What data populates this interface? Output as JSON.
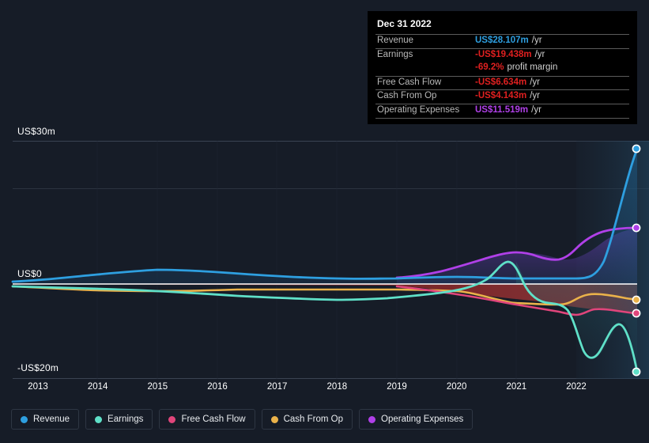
{
  "background_color": "#161c27",
  "axis": {
    "y_top_label": "US$30m",
    "y_zero_label": "US$0",
    "y_bottom_label": "-US$20m",
    "x_ticks": [
      "2013",
      "2014",
      "2015",
      "2016",
      "2017",
      "2018",
      "2019",
      "2020",
      "2021",
      "2022"
    ]
  },
  "tooltip": {
    "date": "Dec 31 2022",
    "rows": [
      {
        "label": "Revenue",
        "value": "US$28.107m",
        "suffix": "/yr",
        "color": "#2e9fe0"
      },
      {
        "label": "Earnings",
        "value": "-US$19.438m",
        "suffix": "/yr",
        "color": "#e02020"
      },
      {
        "label": "",
        "value": "-69.2%",
        "suffix": "profit margin",
        "color": "#e02020"
      },
      {
        "label": "Free Cash Flow",
        "value": "-US$6.634m",
        "suffix": "/yr",
        "color": "#e02020"
      },
      {
        "label": "Cash From Op",
        "value": "-US$4.143m",
        "suffix": "/yr",
        "color": "#e02020"
      },
      {
        "label": "Operating Expenses",
        "value": "US$11.519m",
        "suffix": "/yr",
        "color": "#b040e8"
      }
    ]
  },
  "legend": {
    "items": [
      {
        "label": "Revenue",
        "color": "#2e9fe0"
      },
      {
        "label": "Earnings",
        "color": "#5fe0c8"
      },
      {
        "label": "Free Cash Flow",
        "color": "#e0457b"
      },
      {
        "label": "Cash From Op",
        "color": "#eab24a"
      },
      {
        "label": "Operating Expenses",
        "color": "#b040e8"
      }
    ]
  },
  "chart_data": {
    "type": "line",
    "title": "",
    "xlabel": "",
    "ylabel": "US$",
    "ylim": [
      -20,
      30
    ],
    "xlim": [
      2012.7,
      2022.95
    ],
    "grid": true,
    "legend_position": "bottom",
    "y_ticks": [
      30,
      20,
      0,
      -20
    ],
    "y_tick_labels": [
      "US$30m",
      "",
      "US$0",
      "-US$20m"
    ],
    "x": [
      2013,
      2014,
      2015,
      2016,
      2017,
      2018,
      2019,
      2019.5,
      2020,
      2020.5,
      2021,
      2021.2,
      2021.5,
      2022,
      2022.3,
      2022.6,
      2022.9
    ],
    "series": [
      {
        "name": "Revenue",
        "color": "#2e9fe0",
        "values": [
          0.6,
          1.1,
          1.5,
          1.6,
          1.5,
          1.3,
          1.2,
          1.2,
          1.4,
          1.3,
          1.2,
          1.2,
          1.0,
          1.0,
          1.0,
          14.0,
          28.107
        ]
      },
      {
        "name": "Earnings",
        "color": "#5fe0c8",
        "values": [
          -0.6,
          -0.7,
          -0.8,
          -1.0,
          -1.3,
          -1.8,
          -2.2,
          -2.3,
          -2.3,
          -2.0,
          3.2,
          -1.2,
          -2.0,
          -12.5,
          -15.0,
          -9.5,
          -19.438
        ]
      },
      {
        "name": "Free Cash Flow",
        "color": "#e0457b",
        "values": [
          null,
          null,
          null,
          null,
          null,
          null,
          -0.9,
          -1.2,
          -1.9,
          -2.6,
          -3.2,
          -3.4,
          -3.8,
          -5.2,
          -4.4,
          -4.6,
          -6.634
        ]
      },
      {
        "name": "Cash From Op",
        "color": "#eab24a",
        "values": [
          -0.5,
          -0.8,
          -1.0,
          -0.9,
          -0.8,
          -0.8,
          -0.8,
          -0.8,
          -0.8,
          -1.1,
          -2.2,
          -2.4,
          -2.6,
          -2.5,
          -1.7,
          -2.2,
          -4.143
        ]
      },
      {
        "name": "Operating Expenses",
        "color": "#b040e8",
        "values": [
          null,
          null,
          null,
          null,
          null,
          null,
          1.3,
          1.4,
          1.8,
          3.0,
          4.2,
          4.4,
          4.1,
          3.7,
          5.4,
          8.6,
          11.519
        ]
      }
    ]
  }
}
